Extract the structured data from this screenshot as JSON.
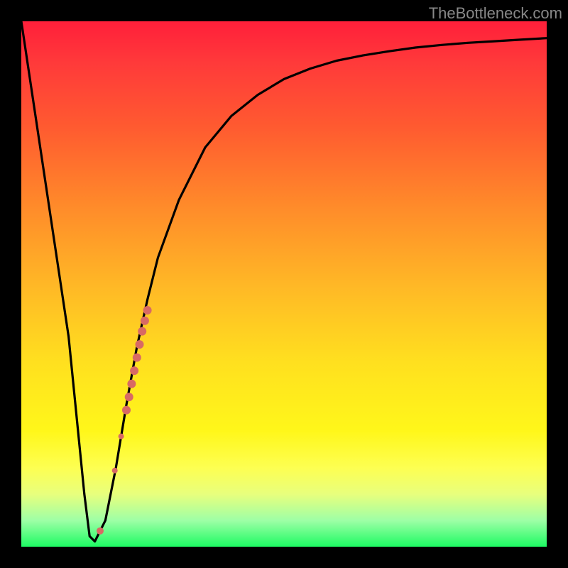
{
  "watermark": {
    "text": "TheBottleneck.com"
  },
  "colors": {
    "frame": "#000000",
    "curve": "#000000",
    "marker": "#d86a64",
    "gradient_stops": [
      "#ff1f3a",
      "#ff3a3a",
      "#ff5a30",
      "#ff8a2a",
      "#ffb726",
      "#ffe01f",
      "#fff71a",
      "#fdff52",
      "#e8ff7d",
      "#9effa6",
      "#1dfb63"
    ]
  },
  "chart_data": {
    "type": "line",
    "title": "",
    "xlabel": "",
    "ylabel": "",
    "xlim": [
      0,
      100
    ],
    "ylim": [
      0,
      100
    ],
    "series": [
      {
        "name": "bottleneck-curve",
        "x": [
          0,
          3,
          6,
          9,
          12,
          13,
          14,
          16,
          18,
          20,
          22,
          24,
          26,
          30,
          35,
          40,
          45,
          50,
          55,
          60,
          65,
          70,
          75,
          80,
          85,
          90,
          95,
          100
        ],
        "y": [
          100,
          80,
          60,
          40,
          10,
          2,
          1,
          5,
          15,
          27,
          38,
          47,
          55,
          66,
          76,
          82,
          86,
          89,
          91,
          92.5,
          93.5,
          94.3,
          95,
          95.5,
          95.9,
          96.2,
          96.5,
          96.8
        ]
      }
    ],
    "markers": [
      {
        "x": 15.0,
        "y": 3.0,
        "r": 5
      },
      {
        "x": 17.8,
        "y": 14.5,
        "r": 4
      },
      {
        "x": 19.0,
        "y": 21.0,
        "r": 4
      },
      {
        "x": 20.0,
        "y": 26.0,
        "r": 6
      },
      {
        "x": 20.5,
        "y": 28.5,
        "r": 6
      },
      {
        "x": 21.0,
        "y": 31.0,
        "r": 6
      },
      {
        "x": 21.5,
        "y": 33.5,
        "r": 6
      },
      {
        "x": 22.0,
        "y": 36.0,
        "r": 6
      },
      {
        "x": 22.5,
        "y": 38.5,
        "r": 6
      },
      {
        "x": 23.0,
        "y": 41.0,
        "r": 6
      },
      {
        "x": 23.5,
        "y": 43.0,
        "r": 6
      },
      {
        "x": 24.0,
        "y": 45.0,
        "r": 6
      }
    ]
  }
}
